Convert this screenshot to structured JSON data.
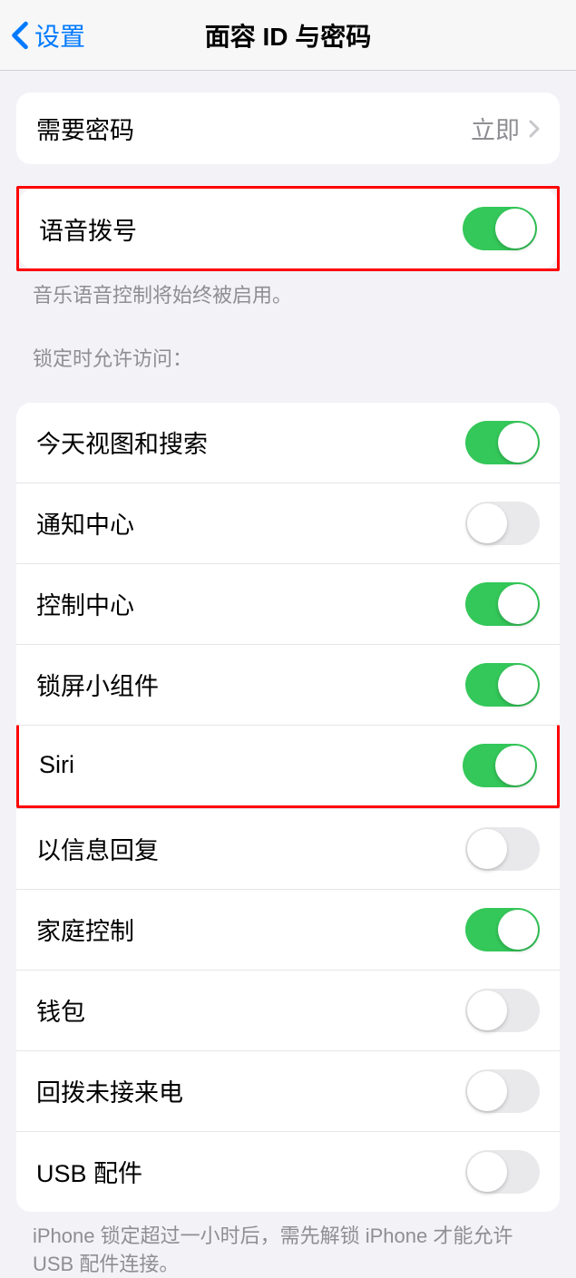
{
  "header": {
    "back_label": "设置",
    "title": "面容 ID 与密码"
  },
  "require_passcode": {
    "label": "需要密码",
    "value": "立即"
  },
  "voice_dial": {
    "label": "语音拨号",
    "on": true,
    "footer": "音乐语音控制将始终被启用。"
  },
  "lock_access": {
    "header": "锁定时允许访问：",
    "items": [
      {
        "label": "今天视图和搜索",
        "on": true,
        "highlighted": false
      },
      {
        "label": "通知中心",
        "on": false,
        "highlighted": false
      },
      {
        "label": "控制中心",
        "on": true,
        "highlighted": false
      },
      {
        "label": "锁屏小组件",
        "on": true,
        "highlighted": false
      },
      {
        "label": "Siri",
        "on": true,
        "highlighted": true
      },
      {
        "label": "以信息回复",
        "on": false,
        "highlighted": false
      },
      {
        "label": "家庭控制",
        "on": true,
        "highlighted": false
      },
      {
        "label": "钱包",
        "on": false,
        "highlighted": false
      },
      {
        "label": "回拨未接来电",
        "on": false,
        "highlighted": false
      },
      {
        "label": "USB 配件",
        "on": false,
        "highlighted": false
      }
    ],
    "footer": "iPhone 锁定超过一小时后，需先解锁 iPhone 才能允许 USB 配件连接。"
  }
}
